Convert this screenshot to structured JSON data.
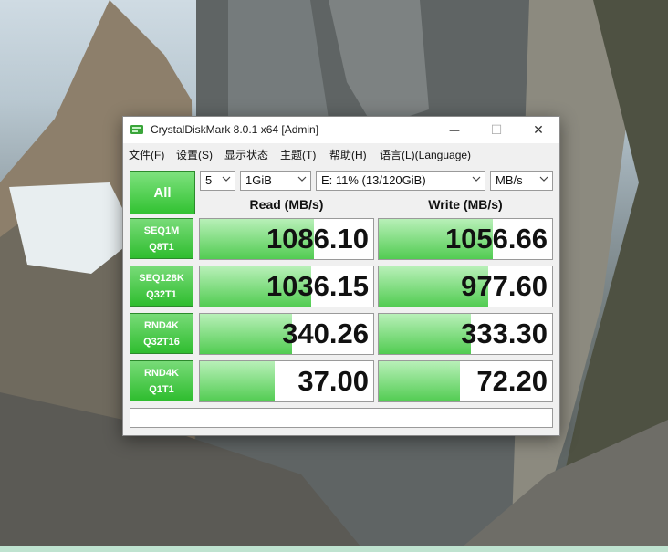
{
  "window": {
    "title": "CrystalDiskMark 8.0.1 x64 [Admin]",
    "controls": {
      "minimize": "—",
      "maximize": "☐",
      "close": "✕"
    }
  },
  "menu": [
    "文件(F)",
    "设置(S)",
    "显示状态",
    "主题(T)",
    "帮助(H)",
    "语言(L)(Language)"
  ],
  "toolbar": {
    "all_label": "All",
    "count": "5",
    "size": "1GiB",
    "drive": "E: 11% (13/120GiB)",
    "unit": "MB/s"
  },
  "headers": {
    "read": "Read (MB/s)",
    "write": "Write (MB/s)"
  },
  "tests": [
    {
      "line1": "SEQ1M",
      "line2": "Q8T1",
      "read": "1086.10",
      "write": "1056.66",
      "read_fill": 0.66,
      "write_fill": 0.66
    },
    {
      "line1": "SEQ128K",
      "line2": "Q32T1",
      "read": "1036.15",
      "write": "977.60",
      "read_fill": 0.64,
      "write_fill": 0.63
    },
    {
      "line1": "RND4K",
      "line2": "Q32T16",
      "read": "340.26",
      "write": "333.30",
      "read_fill": 0.53,
      "write_fill": 0.53
    },
    {
      "line1": "RND4K",
      "line2": "Q1T1",
      "read": "37.00",
      "write": "72.20",
      "read_fill": 0.43,
      "write_fill": 0.47
    }
  ],
  "comment": "",
  "colors": {
    "accent_green": "#32c232",
    "bar_green": "#52cc52",
    "window_bg": "#f0f0f0"
  },
  "icons": {
    "app": "crystaldiskmark-icon",
    "chevron": "chevron-down-icon"
  }
}
